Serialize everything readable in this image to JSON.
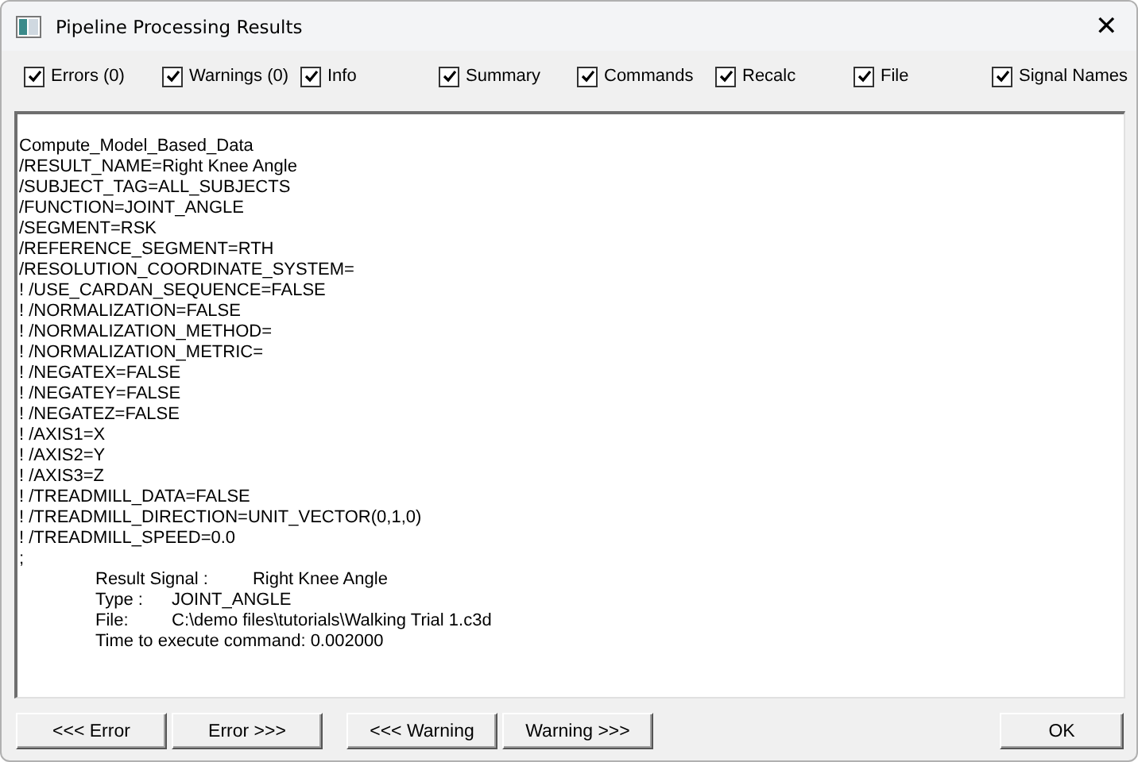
{
  "window": {
    "title": "Pipeline Processing Results",
    "close": "✕"
  },
  "filters": [
    {
      "label": "Errors (0)",
      "checked": true
    },
    {
      "label": "Warnings (0)",
      "checked": true
    },
    {
      "label": "Info",
      "checked": true
    },
    {
      "label": "Summary",
      "checked": true
    },
    {
      "label": "Commands",
      "checked": true
    },
    {
      "label": "Recalc",
      "checked": true
    },
    {
      "label": "File",
      "checked": true
    },
    {
      "label": "Signal Names",
      "checked": true
    }
  ],
  "log_lines": [
    "Compute_Model_Based_Data",
    "/RESULT_NAME=Right Knee Angle",
    "/SUBJECT_TAG=ALL_SUBJECTS",
    "/FUNCTION=JOINT_ANGLE",
    "/SEGMENT=RSK",
    "/REFERENCE_SEGMENT=RTH",
    "/RESOLUTION_COORDINATE_SYSTEM=",
    "! /USE_CARDAN_SEQUENCE=FALSE",
    "! /NORMALIZATION=FALSE",
    "! /NORMALIZATION_METHOD=",
    "! /NORMALIZATION_METRIC=",
    "! /NEGATEX=FALSE",
    "! /NEGATEY=FALSE",
    "! /NEGATEZ=FALSE",
    "! /AXIS1=X",
    "! /AXIS2=Y",
    "! /AXIS3=Z",
    "! /TREADMILL_DATA=FALSE",
    "! /TREADMILL_DIRECTION=UNIT_VECTOR(0,1,0)",
    "! /TREADMILL_SPEED=0.0",
    ";"
  ],
  "details": [
    {
      "label": "Result Signal :",
      "value": "Right Knee Angle"
    },
    {
      "label": "Type :",
      "value": "JOINT_ANGLE"
    },
    {
      "label": "File:",
      "value": "C:\\demo files\\tutorials\\Walking Trial 1.c3d"
    },
    {
      "label": "Time to execute command: 0.002000"
    }
  ],
  "nav_buttons": [
    "<<< Error",
    "Error >>>",
    "<<< Warning",
    "Warning >>>"
  ],
  "ok_button": "OK"
}
